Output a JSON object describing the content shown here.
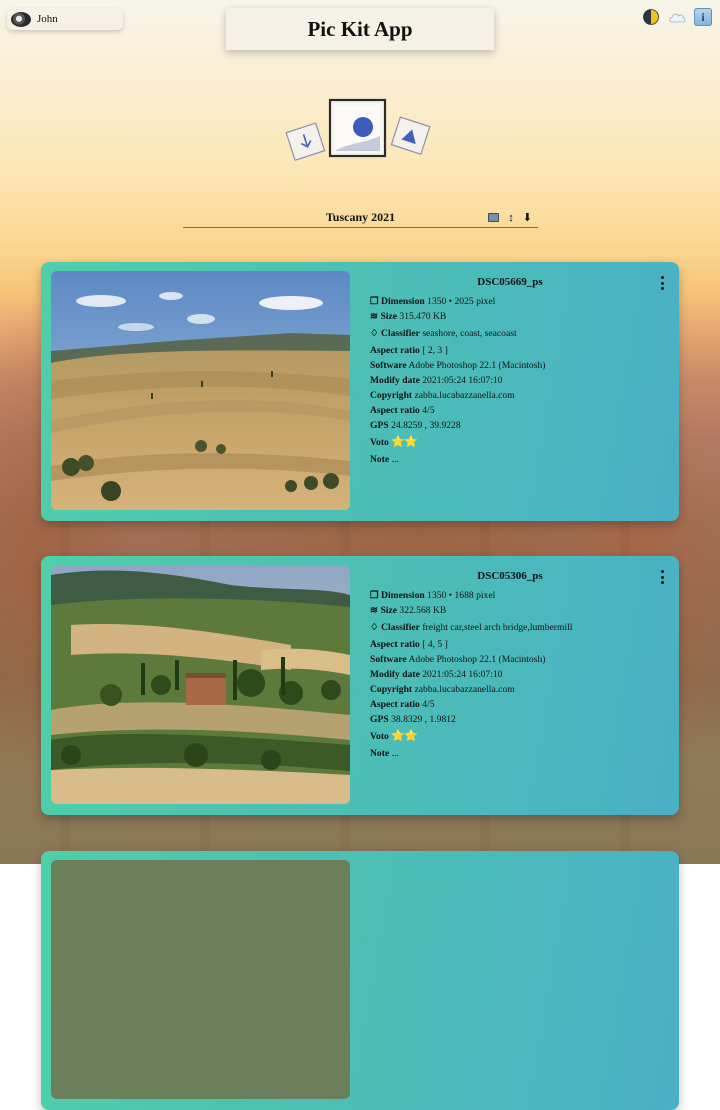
{
  "user": {
    "name": "John",
    "avatar_icon": "avatar-icon"
  },
  "app": {
    "title": "Pic Kit App"
  },
  "toolbar_icons": [
    "moon-icon",
    "cloud-icon",
    "info-icon"
  ],
  "info_label": "i",
  "album": {
    "title": "Tuscany 2021",
    "tools": [
      "image-view-icon",
      "sort-icon",
      "download-icon"
    ],
    "sort_symbol": "↕",
    "download_symbol": "⬇"
  },
  "labels": {
    "dimension": "Dimension",
    "size": "Size",
    "classifier": "Classifier",
    "aspect_ratio": "Aspect ratio",
    "software": "Software",
    "modify_date": "Modify date",
    "copyright": "Copyright",
    "aspect_ratio_2": "Aspect ratio",
    "gps": "GPS",
    "voto": "Voto",
    "note": "Note",
    "dimension_icon": "❐",
    "size_icon": "≋",
    "classifier_icon": "♢"
  },
  "photos": [
    {
      "name": "DSC05669_ps",
      "dimension": "1350 • 2025 pixel",
      "size": "315.470 KB",
      "classifier": "seashore, coast, seacoast",
      "aspect_ratio": "[ 2, 3 ]",
      "software": "Adobe Photoshop 22.1 (Macintosh)",
      "modify_date": "2021:05:24 16:07:10",
      "copyright": "zabba.lucabazzanella.com",
      "aspect_ratio_2": "4/5",
      "gps": "24.8259 , 39.9228",
      "voto": "⭐⭐",
      "note": "..."
    },
    {
      "name": "DSC05306_ps",
      "dimension": "1350 • 1688 pixel",
      "size": "322.568 KB",
      "classifier": "freight car,steel arch bridge,lumbermill",
      "aspect_ratio": "[ 4, 5 ]",
      "software": "Adobe Photoshop 22.1 (Macintosh)",
      "modify_date": "2021:05:24 16:07:10",
      "copyright": "zabba.lucabazzanella.com",
      "aspect_ratio_2": "4/5",
      "gps": "38.8329 , 1.9812",
      "voto": "⭐⭐",
      "note": "..."
    }
  ]
}
